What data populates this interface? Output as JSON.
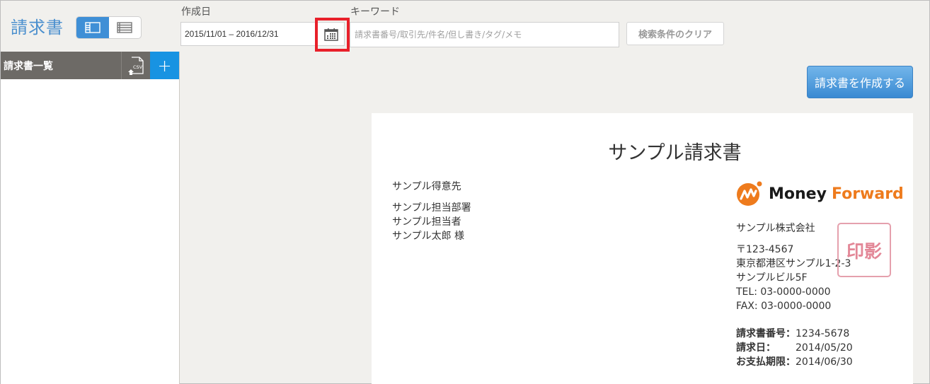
{
  "app": {
    "title": "請求書"
  },
  "view_toggle": {
    "options": [
      "split-view",
      "list-view"
    ],
    "active": "split-view"
  },
  "filters": {
    "date_label": "作成日",
    "date_value": "2015/11/01 – 2016/12/31",
    "keyword_label": "キーワード",
    "keyword_value": "",
    "keyword_placeholder": "請求書番号/取引先/件名/但し書き/タグ/メモ",
    "clear_label": "検索条件のクリア"
  },
  "sidebar": {
    "title": "請求書一覧",
    "csv_label": "CSV",
    "add_label": "+"
  },
  "actions": {
    "create_label": "請求書を作成する"
  },
  "colors": {
    "accent": "#1893e2",
    "title_blue": "#4a8fce",
    "highlight": "#e8202a",
    "brand_orange": "#ee7b1d"
  },
  "invoice": {
    "title": "サンプル請求書",
    "client": {
      "name": "サンプル得意先",
      "department": "サンプル担当部署",
      "contact": "サンプル担当者",
      "person": "サンプル太郎 様"
    },
    "logo": {
      "money": "Money",
      "forward": "Forward"
    },
    "company": {
      "name": "サンプル株式会社",
      "postal": "〒123-4567",
      "address1": "東京都港区サンプル1-2-3",
      "address2": "サンプルビル5F",
      "tel": "TEL: 03-0000-0000",
      "fax": "FAX: 03-0000-0000"
    },
    "stamp": "印影",
    "meta": [
      {
        "key": "請求書番号：",
        "value": "1234-5678"
      },
      {
        "key": "請求日：",
        "value": "2014/05/20"
      },
      {
        "key": "お支払期限：",
        "value": "2014/06/30"
      }
    ]
  }
}
